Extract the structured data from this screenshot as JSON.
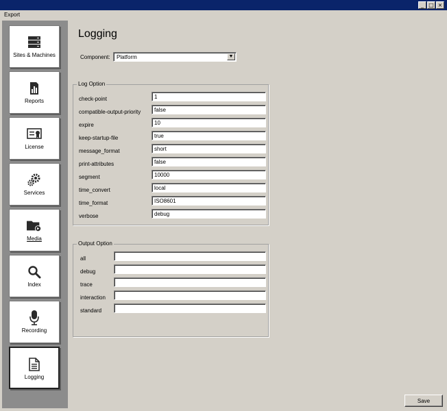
{
  "window": {
    "minimize_glyph": "_",
    "maximize_glyph": "□",
    "close_glyph": "×"
  },
  "menu": {
    "items": [
      {
        "label": "Export"
      }
    ]
  },
  "sidebar": {
    "items": [
      {
        "label": "Sites & Machines",
        "icon": "server-icon",
        "active": false
      },
      {
        "label": "Reports",
        "icon": "report-chart-icon",
        "active": false
      },
      {
        "label": "License",
        "icon": "license-certificate-icon",
        "active": false
      },
      {
        "label": "Services",
        "icon": "gears-icon",
        "active": false
      },
      {
        "label": "Media",
        "icon": "media-folder-icon",
        "active": false
      },
      {
        "label": "Index",
        "icon": "magnifier-icon",
        "active": false
      },
      {
        "label": "Recording",
        "icon": "microphone-icon",
        "active": false
      },
      {
        "label": "Logging",
        "icon": "log-document-icon",
        "active": true
      }
    ]
  },
  "page": {
    "title": "Logging",
    "component_label": "Component:",
    "component_value": "Platform"
  },
  "log_option": {
    "legend": "Log Option",
    "rows": [
      {
        "label": "check-point",
        "value": "1"
      },
      {
        "label": "compatible-output-priority",
        "value": "false"
      },
      {
        "label": "expire",
        "value": "10"
      },
      {
        "label": "keep-startup-file",
        "value": "true"
      },
      {
        "label": "message_format",
        "value": "short"
      },
      {
        "label": "print-attributes",
        "value": "false"
      },
      {
        "label": "segment",
        "value": "10000"
      },
      {
        "label": "time_convert",
        "value": "local"
      },
      {
        "label": "time_format",
        "value": "ISO8601"
      },
      {
        "label": "verbose",
        "value": "debug"
      }
    ]
  },
  "output_option": {
    "legend": "Output Option",
    "rows": [
      {
        "label": "all",
        "value": ""
      },
      {
        "label": "debug",
        "value": ""
      },
      {
        "label": "trace",
        "value": ""
      },
      {
        "label": "interaction",
        "value": ""
      },
      {
        "label": "standard",
        "value": ""
      }
    ]
  },
  "footer": {
    "save_label": "Save"
  }
}
